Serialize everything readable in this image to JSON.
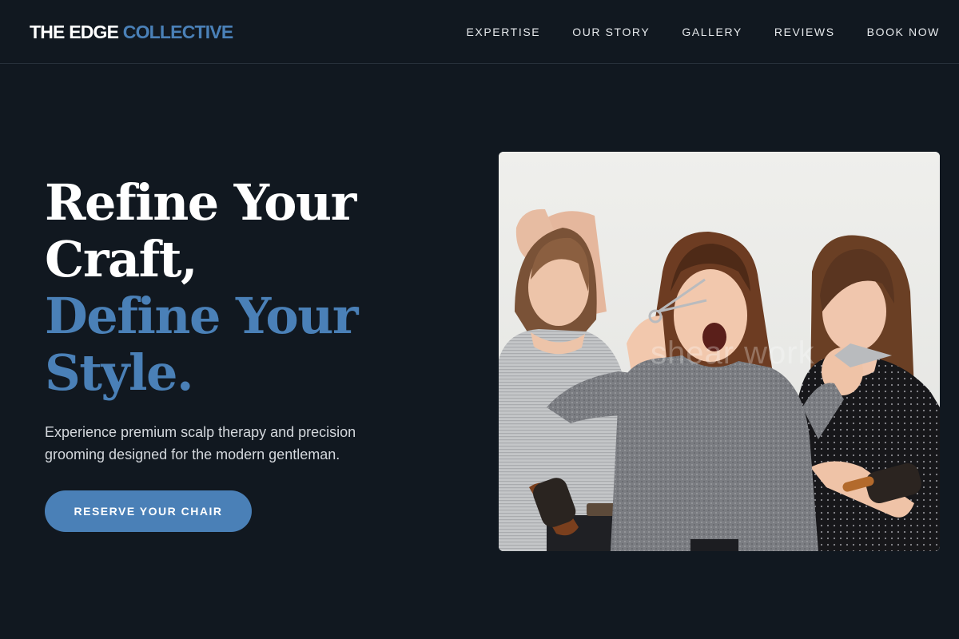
{
  "brand": {
    "name_main": "THE EDGE ",
    "name_accent": "COLLECTIVE"
  },
  "nav": {
    "items": [
      "EXPERTISE",
      "OUR STORY",
      "GALLERY",
      "REVIEWS",
      "BOOK NOW"
    ]
  },
  "hero": {
    "headline_line1": "Refine Your",
    "headline_line2": "Craft,",
    "headline_line3": "Define Your",
    "headline_line4": "Style.",
    "subtext": "Experience premium scalp therapy and precision grooming designed for the modern gentleman.",
    "cta_label": "RESERVE YOUR CHAIR"
  },
  "image": {
    "watermark": "shear work"
  },
  "colors": {
    "background": "#111820",
    "accent": "#4a80b7",
    "text": "#ffffff",
    "subtext": "#d4d8dd"
  }
}
